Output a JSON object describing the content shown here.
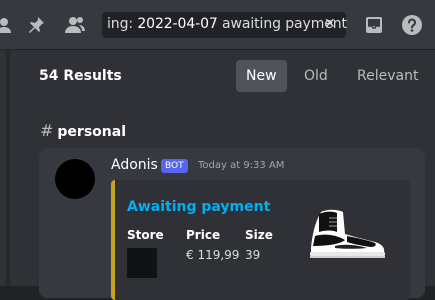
{
  "search": {
    "prefix": "ing: ",
    "date": "2022-04-07",
    "suffix": " awaiting payment",
    "clear_label": "✕"
  },
  "results": {
    "count_label": "54 Results",
    "sort_options": [
      "New",
      "Old",
      "Relevant"
    ],
    "active_sort": "New"
  },
  "channel": {
    "hash": "#",
    "name": "personal"
  },
  "message": {
    "author": "Adonis",
    "badge": "BOT",
    "timestamp": "Today at 9:33 AM",
    "embed": {
      "accent_color": "#c6a321",
      "title": "Awaiting payment",
      "fields": [
        {
          "name": "Store",
          "value": ""
        },
        {
          "name": "Price",
          "value": "€ 119,99"
        },
        {
          "name": "Size",
          "value": "39"
        }
      ],
      "thumbnail": "sneaker-image"
    }
  },
  "colors": {
    "link_blue": "#00aff4",
    "bot_badge": "#5865f2"
  }
}
